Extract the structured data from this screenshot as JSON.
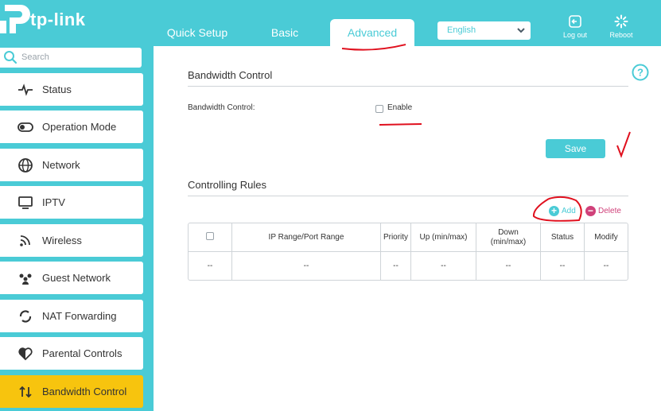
{
  "brand": {
    "logo_text": "tp-link"
  },
  "nav": {
    "tabs": [
      {
        "label": "Quick Setup"
      },
      {
        "label": "Basic"
      },
      {
        "label": "Advanced"
      }
    ],
    "language": "English",
    "logout_label": "Log out",
    "reboot_label": "Reboot"
  },
  "sidebar": {
    "search_placeholder": "Search",
    "items": [
      {
        "label": "Status",
        "icon": "pulse-icon"
      },
      {
        "label": "Operation Mode",
        "icon": "toggle-icon"
      },
      {
        "label": "Network",
        "icon": "globe-icon"
      },
      {
        "label": "IPTV",
        "icon": "monitor-icon"
      },
      {
        "label": "Wireless",
        "icon": "wifi-icon"
      },
      {
        "label": "Guest Network",
        "icon": "guests-icon"
      },
      {
        "label": "NAT Forwarding",
        "icon": "nat-icon"
      },
      {
        "label": "Parental Controls",
        "icon": "heart-icon"
      },
      {
        "label": "Bandwidth Control",
        "icon": "arrows-updown-icon"
      }
    ]
  },
  "main": {
    "bandwidth_title": "Bandwidth Control",
    "bandwidth_label": "Bandwidth Control:",
    "enable_label": "Enable",
    "enable_checked": false,
    "save_label": "Save",
    "rules_title": "Controlling Rules",
    "add_label": "Add",
    "delete_label": "Delete",
    "table": {
      "headers": [
        "",
        "IP Range/Port Range",
        "Priority",
        "Up (min/max)",
        "Down\n(min/max)",
        "Status",
        "Modify"
      ],
      "rows": [
        [
          "--",
          "--",
          "--",
          "--",
          "--",
          "--",
          "--"
        ]
      ]
    }
  },
  "colors": {
    "accent": "#4acbd6",
    "active_item": "#f7c40e",
    "delete": "#d0417a",
    "annotation": "#e0101e"
  }
}
